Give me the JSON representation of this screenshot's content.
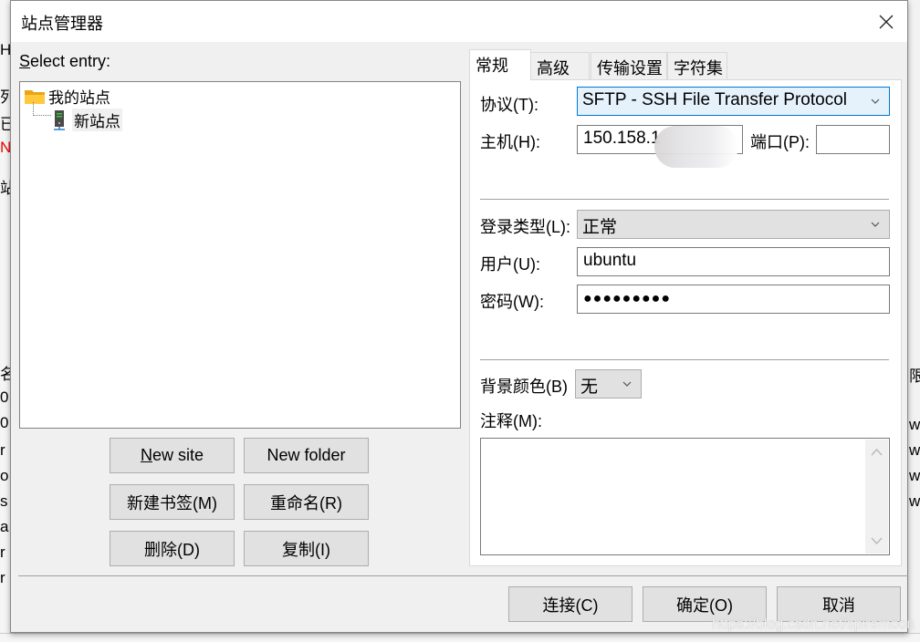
{
  "window": {
    "title": "站点管理器",
    "close_icon": "close-icon"
  },
  "background": {
    "left_glyphs": [
      "H",
      "列",
      "已",
      "N",
      "站",
      "名",
      "0",
      "0",
      "r",
      "o",
      "s",
      "a",
      "r",
      "r"
    ],
    "right_glyphs": [
      "限",
      "w",
      "w",
      "w",
      "w"
    ]
  },
  "left": {
    "select_entry_label": "Select entry:",
    "select_entry_mnemonic": "S",
    "tree": {
      "folder": {
        "label": "我的站点",
        "icon": "folder-icon"
      },
      "site": {
        "label": "新站点",
        "icon": "server-icon",
        "selected": true
      }
    },
    "buttons": {
      "new_site": "New site",
      "new_folder": "New folder",
      "new_bookmark": "新建书签(M)",
      "rename": "重命名(R)",
      "delete": "删除(D)",
      "duplicate": "复制(I)"
    }
  },
  "tabs": [
    {
      "label": "常规",
      "active": true
    },
    {
      "label": "高级",
      "active": false
    },
    {
      "label": "传输设置",
      "active": false
    },
    {
      "label": "字符集",
      "active": false
    }
  ],
  "general": {
    "protocol_label": "协议(T):",
    "protocol_value": "SFTP - SSH File Transfer Protocol",
    "host_label": "主机(H):",
    "host_value": "150.158.1",
    "port_label": "端口(P):",
    "port_value": "",
    "logon_type_label": "登录类型(L):",
    "logon_type_value": "正常",
    "user_label": "用户(U):",
    "user_value": "ubuntu",
    "password_label": "密码(W):",
    "password_value": "●●●●●●●●●",
    "bg_color_label": "背景颜色(B)",
    "bg_color_value": "无",
    "comments_label": "注释(M):",
    "comments_value": ""
  },
  "footer": {
    "connect": "连接(C)",
    "ok": "确定(O)",
    "cancel": "取消"
  },
  "watermark": "https://blog.csdn.net/spiremoon"
}
